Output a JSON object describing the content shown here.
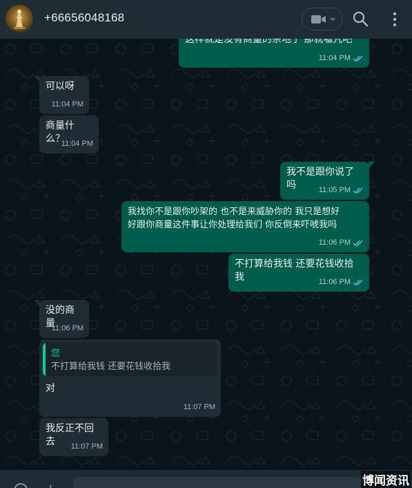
{
  "header": {
    "contact_name": "+66656048168",
    "icons": [
      "avatar",
      "video-call-icon",
      "chevron-down-icon",
      "search-icon",
      "menu-icon"
    ]
  },
  "messages": [
    {
      "dir": "out",
      "text": "这样就是没有商量的余地了 那就嘘咒吧",
      "time": "11:04 PM",
      "status": "read"
    },
    {
      "dir": "in",
      "text": "可以呀",
      "time": "11:04 PM"
    },
    {
      "dir": "in",
      "text": "商量什么？",
      "time": "11:04 PM"
    },
    {
      "dir": "out",
      "text": "我不是跟你说了吗",
      "time": "11:05 PM",
      "status": "read"
    },
    {
      "dir": "out",
      "text": "我找你不是跟你吵架的 也不是来威胁你的 我只是想好\n好跟你商量这件事让你处理给我们 你反倒来吓唬我吗",
      "time": "11:06 PM",
      "status": "read"
    },
    {
      "dir": "out",
      "text": "不打算给我钱 还要花钱收拾我",
      "time": "11:06 PM",
      "status": "read"
    },
    {
      "dir": "in",
      "text": "没的商量",
      "time": "11:06 PM"
    },
    {
      "dir": "in",
      "text": "对",
      "time": "11:07 PM",
      "quote": {
        "author": "您",
        "text": "不打算给我钱 还要花钱收拾我"
      }
    },
    {
      "dir": "in",
      "text": "我反正不回去",
      "time": "11:07 PM"
    }
  ],
  "watermark": "博闻资讯",
  "colors": {
    "background": "#0b141a",
    "header": "#202c33",
    "incoming_bubble": "#202c33",
    "outgoing_bubble": "#005c4b",
    "read_ticks": "#53bdeb",
    "quote_accent": "#06cf9c"
  }
}
